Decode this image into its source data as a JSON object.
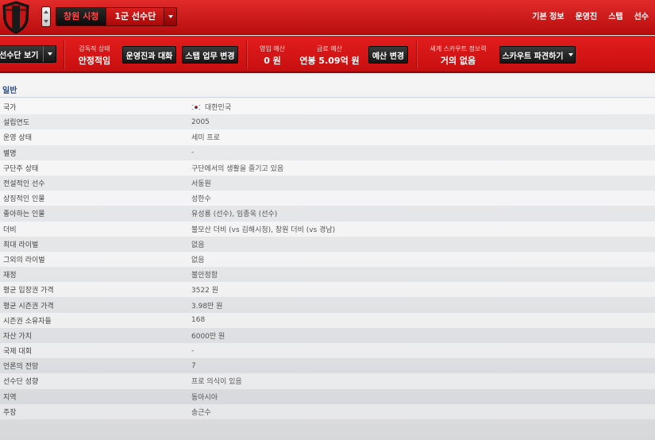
{
  "header": {
    "club_name": "창원 시청",
    "squad_name": "1군 선수단",
    "nav": [
      "기본 정보",
      "운영진",
      "스탭",
      "선수"
    ]
  },
  "toolbar": {
    "squad_view_label": "선수단 보기",
    "manager_status_label": "감독직 상태",
    "manager_status_value": "안정적임",
    "board_talk_label": "운영진과 대화",
    "staff_duties_label": "스탭 업무 변경",
    "transfer_budget_label": "영입 예산",
    "transfer_budget_value": "0 원",
    "wage_budget_label": "급료 예산",
    "wage_budget_value": "연봉 5.09억 원",
    "budget_change_label": "예산 변경",
    "scout_range_label": "세계 스카우트 정보력",
    "scout_range_value": "거의 없음",
    "scout_dispatch_label": "스카우트 파견하기"
  },
  "section": {
    "title": "일반",
    "rows": [
      {
        "key": "국가",
        "value": "대한민국"
      },
      {
        "key": "설립연도",
        "value": "2005"
      },
      {
        "key": "운영 상태",
        "value": "세미 프로"
      },
      {
        "key": "별명",
        "value": "-"
      },
      {
        "key": "구단주 상태",
        "value": "구단에서의 생활을 즐기고 있음"
      },
      {
        "key": "전설적인 선수",
        "value": "서동원"
      },
      {
        "key": "상징적인 인물",
        "value": "성한수"
      },
      {
        "key": "좋아하는 인물",
        "value": "유성룡 (선수), 임종욱 (선수)"
      },
      {
        "key": "더비",
        "value": "불모산 더비 (vs 김해시청), 창원 더비 (vs 경남)"
      },
      {
        "key": "최대 라이벌",
        "value": "없음"
      },
      {
        "key": "그외의 라이벌",
        "value": "없음"
      },
      {
        "key": "재정",
        "value": "불안정함"
      },
      {
        "key": "평균 입장권 가격",
        "value": "3522 원"
      },
      {
        "key": "평균 시즌권 가격",
        "value": "3.98만 원"
      },
      {
        "key": "시즌권 소유자들",
        "value": "168"
      },
      {
        "key": "자산 가치",
        "value": "6000만 원"
      },
      {
        "key": "국제 대회",
        "value": "-"
      },
      {
        "key": "언론의 전망",
        "value": "7"
      },
      {
        "key": "선수단 성향",
        "value": "프로 의식이 있음"
      },
      {
        "key": "지역",
        "value": "동아시아"
      },
      {
        "key": "주장",
        "value": "송근수"
      }
    ]
  },
  "colors": {
    "accent_red": "#d81818",
    "button_dark": "#1f1f1f",
    "section_title": "#2d4e8a"
  }
}
